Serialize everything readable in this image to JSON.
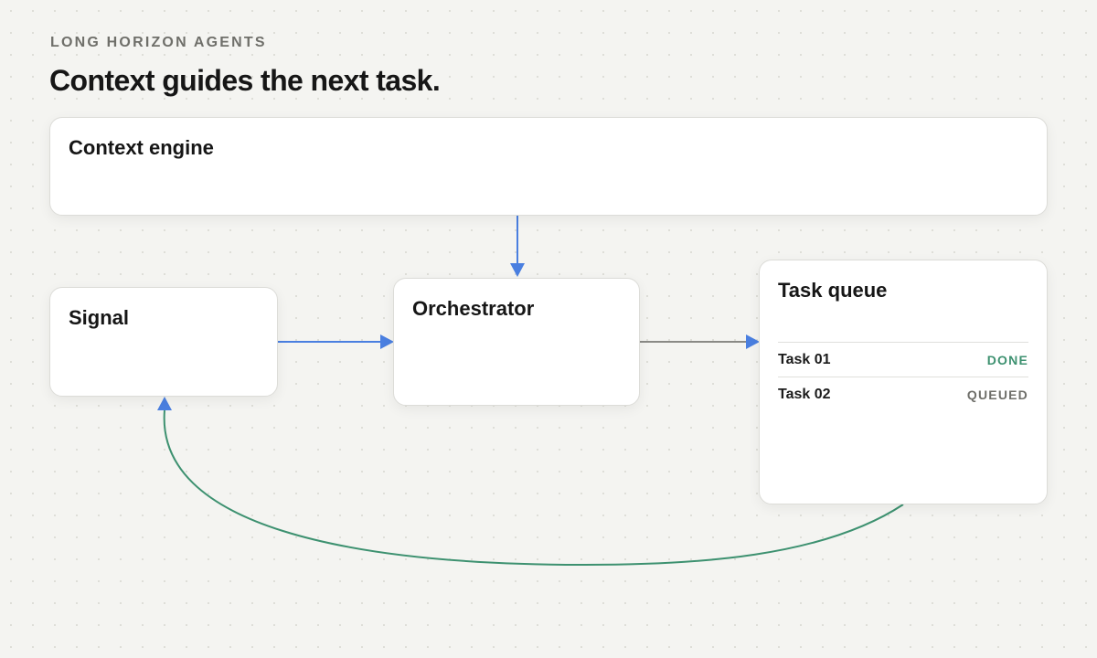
{
  "header": {
    "eyebrow": "LONG HORIZON AGENTS",
    "title": "Context guides the next task."
  },
  "nodes": {
    "context_engine": {
      "title": "Context engine"
    },
    "signal": {
      "title": "Signal"
    },
    "orchestrator": {
      "title": "Orchestrator"
    },
    "task_queue": {
      "title": "Task queue",
      "tasks": [
        {
          "name": "Task 01",
          "status": "DONE"
        },
        {
          "name": "Task 02",
          "status": "QUEUED"
        }
      ]
    }
  },
  "colors": {
    "flow_primary": "#4a7fe0",
    "flow_output": "#8a8a86",
    "feedback_loop": "#3d9170",
    "status_done": "#3d9170",
    "status_queued": "#6f6f6a"
  }
}
